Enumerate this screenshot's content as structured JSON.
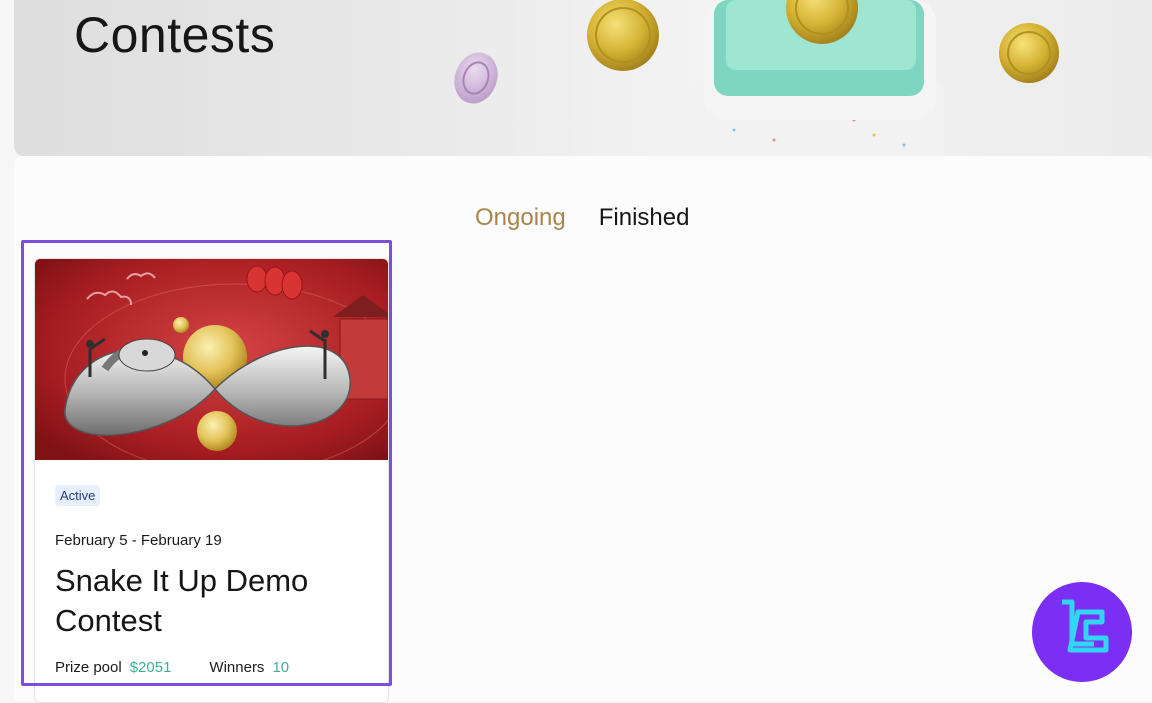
{
  "hero": {
    "title": "Contests"
  },
  "tabs": [
    {
      "label": "Ongoing",
      "active": true
    },
    {
      "label": "Finished",
      "active": false
    }
  ],
  "contest_card": {
    "status": "Active",
    "dates": "February 5 - February 19",
    "title": "Snake It Up Demo Contest",
    "prize_pool_label": "Prize pool",
    "prize_pool_value": "$2051",
    "winners_label": "Winners",
    "winners_value": "10"
  },
  "colors": {
    "tab_active": "#a6864a",
    "accent_value": "#3fae96",
    "highlight_border": "#7a4fe0",
    "logo_bg": "#7b2ff2",
    "logo_mark": "#33d6f2"
  }
}
